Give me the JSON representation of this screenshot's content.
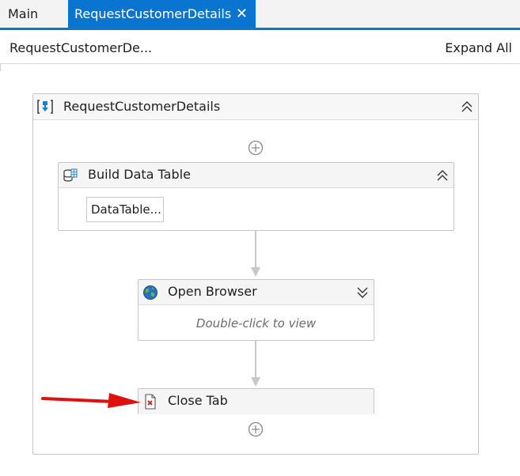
{
  "tabs": [
    {
      "label": "Main",
      "active": false
    },
    {
      "label": "RequestCustomerDetails",
      "active": true,
      "close_glyph": "✕"
    }
  ],
  "breadcrumb": {
    "label": "RequestCustomerDe..."
  },
  "expand_all": {
    "label": "Expand All"
  },
  "sequence": {
    "title": "RequestCustomerDetails",
    "icon": "sequence-icon",
    "state": "expanded"
  },
  "activities": [
    {
      "title": "Build Data Table",
      "icon": "datatable-icon",
      "state": "expanded",
      "field": "DataTable..."
    },
    {
      "title": "Open Browser",
      "icon": "globe-icon",
      "state": "collapsed",
      "hint": "Double-click to view"
    },
    {
      "title": "Close Tab",
      "icon": "close-tab-icon"
    }
  ],
  "annotation": {
    "arrow_color": "#e01010"
  },
  "colors": {
    "accent": "#0a75d1"
  }
}
